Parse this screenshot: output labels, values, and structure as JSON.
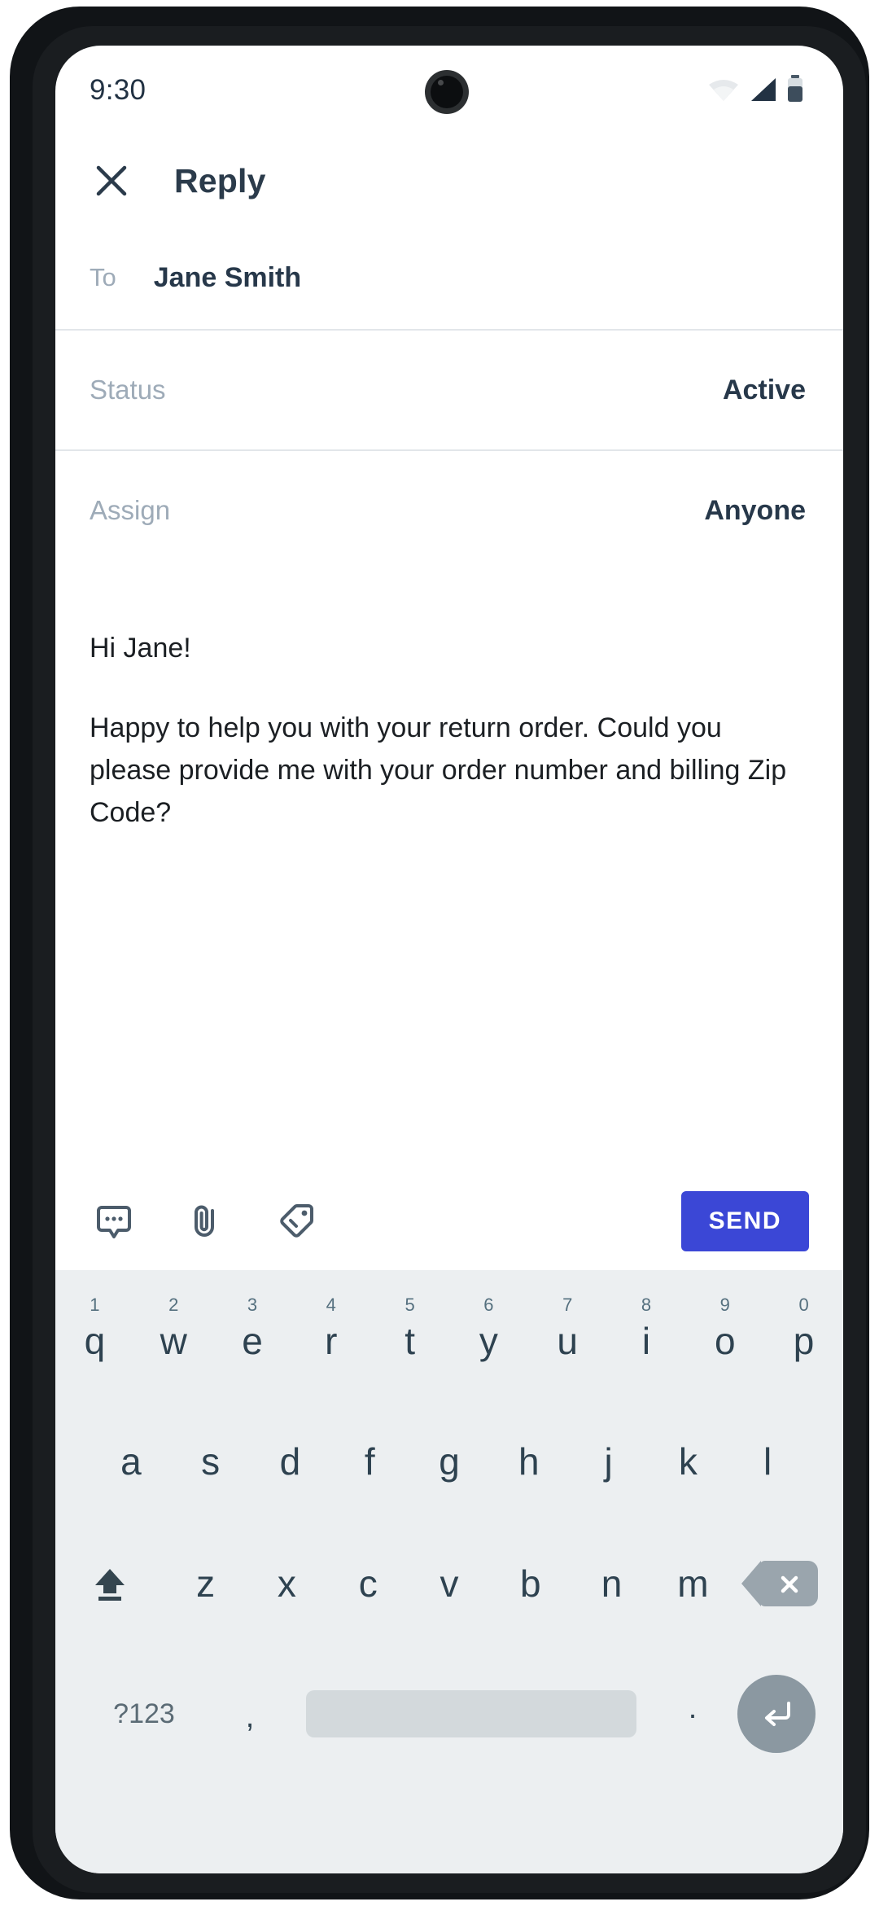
{
  "status_bar": {
    "time": "9:30",
    "icons": [
      "wifi-icon",
      "cellular-signal-icon",
      "battery-icon"
    ]
  },
  "app_bar": {
    "close_icon": "close-icon",
    "title": "Reply"
  },
  "fields": [
    {
      "label": "To",
      "value": "Jane Smith",
      "name": "to"
    },
    {
      "label": "Status",
      "value": "Active",
      "name": "status"
    },
    {
      "label": "Assign",
      "value": "Anyone",
      "name": "assign"
    }
  ],
  "message": {
    "greeting": "Hi Jane!",
    "paragraph": "Happy to help you with your return order. Could you please provide me with your order number and billing Zip Code?"
  },
  "compose_toolbar": {
    "icons": [
      {
        "name": "canned-response-icon",
        "label": "Canned response"
      },
      {
        "name": "attachment-icon",
        "label": "Attach file"
      },
      {
        "name": "tag-icon",
        "label": "Add tag"
      }
    ],
    "send_label": "SEND",
    "send_color": "#3b47d6"
  },
  "keyboard": {
    "row1": [
      {
        "letter": "q",
        "num": "1"
      },
      {
        "letter": "w",
        "num": "2"
      },
      {
        "letter": "e",
        "num": "3"
      },
      {
        "letter": "r",
        "num": "4"
      },
      {
        "letter": "t",
        "num": "5"
      },
      {
        "letter": "y",
        "num": "6"
      },
      {
        "letter": "u",
        "num": "7"
      },
      {
        "letter": "i",
        "num": "8"
      },
      {
        "letter": "o",
        "num": "9"
      },
      {
        "letter": "p",
        "num": "0"
      }
    ],
    "row2": [
      {
        "letter": "a"
      },
      {
        "letter": "s"
      },
      {
        "letter": "d"
      },
      {
        "letter": "f"
      },
      {
        "letter": "g"
      },
      {
        "letter": "h"
      },
      {
        "letter": "j"
      },
      {
        "letter": "k"
      },
      {
        "letter": "l"
      }
    ],
    "row3": [
      {
        "letter": "z"
      },
      {
        "letter": "x"
      },
      {
        "letter": "c"
      },
      {
        "letter": "v"
      },
      {
        "letter": "b"
      },
      {
        "letter": "n"
      },
      {
        "letter": "m"
      }
    ],
    "shift_icon": "shift-icon",
    "backspace_icon": "backspace-icon",
    "symbols_label": "?123",
    "comma_label": ",",
    "period_label": ".",
    "enter_icon": "enter-icon"
  }
}
